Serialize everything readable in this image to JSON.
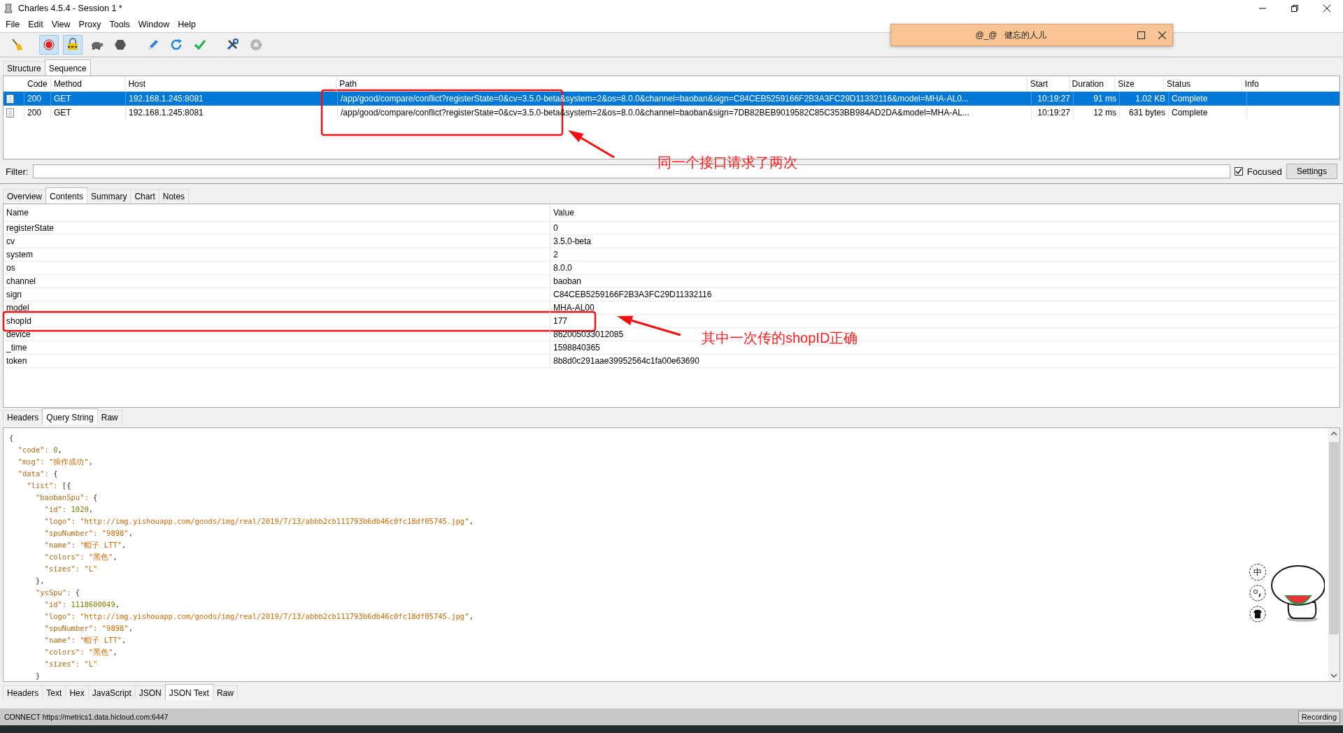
{
  "window": {
    "title": "Charles 4.5.4 - Session 1 *"
  },
  "menu": [
    "File",
    "Edit",
    "View",
    "Proxy",
    "Tools",
    "Window",
    "Help"
  ],
  "toolbar": [
    {
      "kind": "broom",
      "pressed": false
    },
    {
      "kind": "record",
      "pressed": true
    },
    {
      "kind": "throttle",
      "pressed": true
    },
    {
      "kind": "turtle",
      "pressed": false
    },
    {
      "kind": "stop",
      "pressed": false
    },
    {
      "kind": "pen",
      "pressed": false
    },
    {
      "kind": "refresh",
      "pressed": false
    },
    {
      "kind": "check",
      "pressed": false
    },
    {
      "kind": "tools",
      "pressed": false
    },
    {
      "kind": "gear",
      "pressed": false
    }
  ],
  "view_tabs": [
    {
      "label": "Structure",
      "selected": false
    },
    {
      "label": "Sequence",
      "selected": true
    }
  ],
  "requests": {
    "columns": [
      "Code",
      "Method",
      "Host",
      "Path",
      "Start",
      "Duration",
      "Size",
      "Status",
      "Info"
    ],
    "rows": [
      {
        "selected": true,
        "code": "200",
        "method": "GET",
        "host": "192.168.1.245:8081",
        "path": "/app/good/compare/conflict?registerState=0&cv=3.5.0-beta&system=2&os=8.0.0&channel=baoban&sign=C84CEB5259166F2B3A3FC29D11332116&model=MHA-AL0...",
        "start": "10:19:27",
        "duration": "91 ms",
        "size": "1.02 KB",
        "status": "Complete"
      },
      {
        "selected": false,
        "code": "200",
        "method": "GET",
        "host": "192.168.1.245:8081",
        "path": "/app/good/compare/conflict?registerState=0&cv=3.5.0-beta&system=2&os=8.0.0&channel=baoban&sign=7DB82BEB9019582C85C353BB984AD2DA&model=MHA-AL...",
        "start": "10:19:27",
        "duration": "12 ms",
        "size": "631 bytes",
        "status": "Complete"
      }
    ]
  },
  "filter": {
    "label": "Filter:",
    "focused": {
      "label": "Focused",
      "checked": true
    },
    "settings": "Settings"
  },
  "detail_tabs": [
    {
      "label": "Overview",
      "selected": false
    },
    {
      "label": "Contents",
      "selected": true
    },
    {
      "label": "Summary",
      "selected": false
    },
    {
      "label": "Chart",
      "selected": false
    },
    {
      "label": "Notes",
      "selected": false
    }
  ],
  "parameters": {
    "columns": [
      "Name",
      "Value"
    ],
    "rows": [
      {
        "name": "registerState",
        "value": "0"
      },
      {
        "name": "cv",
        "value": "3.5.0-beta"
      },
      {
        "name": "system",
        "value": "2"
      },
      {
        "name": "os",
        "value": "8.0.0"
      },
      {
        "name": "channel",
        "value": "baoban"
      },
      {
        "name": "sign",
        "value": "C84CEB5259166F2B3A3FC29D11332116"
      },
      {
        "name": "model",
        "value": "MHA-AL00"
      },
      {
        "name": "shopId",
        "value": "177"
      },
      {
        "name": "device",
        "value": "862005033012085"
      },
      {
        "name": "_time",
        "value": "1598840365"
      },
      {
        "name": "token",
        "value": "8b8d0c291aae39952564c1fa00e63690"
      }
    ]
  },
  "request_tabs": [
    {
      "label": "Headers",
      "selected": false
    },
    {
      "label": "Query String",
      "selected": true
    },
    {
      "label": "Raw",
      "selected": false
    }
  ],
  "response_body": {
    "lines": [
      {
        "kind": "brace",
        "key": "{"
      },
      {
        "kind": "number",
        "key": "  \"code\": ",
        "value": "0",
        "tail": ","
      },
      {
        "kind": "string",
        "key": "  \"msg\": ",
        "value": "\"操作成功\"",
        "tail": ","
      },
      {
        "kind": "open",
        "key": "  \"data\": ",
        "value": "{"
      },
      {
        "kind": "open",
        "key": "    \"list\": ",
        "value": "[{"
      },
      {
        "kind": "open",
        "key": "      \"baobanSpu\": ",
        "value": "{"
      },
      {
        "kind": "number",
        "key": "        \"id\": ",
        "value": "1020",
        "tail": ","
      },
      {
        "kind": "string",
        "key": "        \"logo\": ",
        "value": "\"http://img.yishouapp.com/goods/img/real/2019/7/13/abbb2cb111793b6db46c0fc18df05745.jpg\"",
        "tail": ","
      },
      {
        "kind": "string",
        "key": "        \"spuNumber\": ",
        "value": "\"9898\"",
        "tail": ","
      },
      {
        "kind": "string",
        "key": "        \"name\": ",
        "value": "\"帽子 LTT\"",
        "tail": ","
      },
      {
        "kind": "string",
        "key": "        \"colors\": ",
        "value": "\"黑色\"",
        "tail": ","
      },
      {
        "kind": "string",
        "key": "        \"sizes\": ",
        "value": "\"L\""
      },
      {
        "kind": "brace",
        "key": "      },"
      },
      {
        "kind": "open",
        "key": "      \"ysSpu\": ",
        "value": "{"
      },
      {
        "kind": "number",
        "key": "        \"id\": ",
        "value": "1118600049",
        "tail": ","
      },
      {
        "kind": "string",
        "key": "        \"logo\": ",
        "value": "\"http://img.yishouapp.com/goods/img/real/2019/7/13/abbb2cb111793b6db46c0fc18df05745.jpg\"",
        "tail": ","
      },
      {
        "kind": "string",
        "key": "        \"spuNumber\": ",
        "value": "\"9898\"",
        "tail": ","
      },
      {
        "kind": "string",
        "key": "        \"name\": ",
        "value": "\"帽子 LTT\"",
        "tail": ","
      },
      {
        "kind": "string",
        "key": "        \"colors\": ",
        "value": "\"黑色\"",
        "tail": ","
      },
      {
        "kind": "string",
        "key": "        \"sizes\": ",
        "value": "\"L\""
      },
      {
        "kind": "brace",
        "key": "      }"
      }
    ]
  },
  "response_tabs": [
    {
      "label": "Headers",
      "selected": false
    },
    {
      "label": "Text",
      "selected": false
    },
    {
      "label": "Hex",
      "selected": false
    },
    {
      "label": "JavaScript",
      "selected": false
    },
    {
      "label": "JSON",
      "selected": false
    },
    {
      "label": "JSON Text",
      "selected": true
    },
    {
      "label": "Raw",
      "selected": false
    }
  ],
  "status_bar": {
    "message": "CONNECT https://metrics1.data.hicloud.com:6447",
    "recording": "Recording"
  },
  "floating_window": {
    "title": "@_@   健忘的人儿"
  },
  "ime_toolbar": [
    {
      "kind": "text",
      "label": "中"
    },
    {
      "kind": "punctuation"
    },
    {
      "kind": "skin"
    }
  ],
  "annotations": [
    {
      "text": "同一个接口请求了两次"
    },
    {
      "text": "其中一次传的shopID正确"
    }
  ]
}
